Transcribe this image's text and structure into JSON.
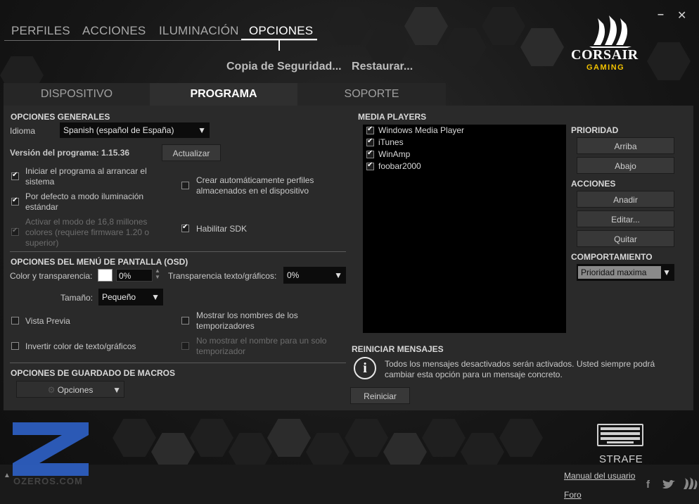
{
  "nav": {
    "tabs": [
      "PERFILES",
      "ACCIONES",
      "ILUMINACIÓN",
      "OPCIONES"
    ],
    "active": "OPCIONES",
    "backup": "Copia de Seguridad...",
    "restore": "Restaurar..."
  },
  "window": {
    "minimize": "–",
    "close": "✕"
  },
  "logo": {
    "brand": "CORSAIR",
    "sub": "GAMING"
  },
  "subtabs": [
    "DISPOSITIVO",
    "PROGRAMA",
    "SOPORTE"
  ],
  "general": {
    "title": "OPCIONES GENERALES",
    "language_label": "Idioma",
    "language_value": "Spanish (español de España)",
    "version": "Versión del programa: 1.15.36",
    "update_button": "Actualizar",
    "start_with_system": "Iniciar el programa al arrancar el sistema",
    "default_lighting": "Por defecto a modo iluminación estándar",
    "sixteen_million": "Activar el modo de 16,8 millones colores (requiere firmware 1.20 o superior)",
    "auto_profiles": "Crear automáticamente perfiles almacenados en el dispositivo",
    "enable_sdk": "Habilitar SDK"
  },
  "osd": {
    "title": "OPCIONES DEL MENÚ DE PANTALLA (OSD)",
    "color_label": "Color y transparencia:",
    "color_value": "0%",
    "text_transparency_label": "Transparencia texto/gráficos:",
    "text_transparency_value": "0%",
    "size_label": "Tamaño:",
    "size_value": "Pequeño",
    "preview": "Vista Previa",
    "show_timers": "Mostrar los nombres de los temporizadores",
    "invert_color": "Invertir color de texto/gráficos",
    "single_timer": "No mostrar el nombre para un solo temporizador"
  },
  "macros": {
    "title": "OPCIONES DE GUARDADO DE MACROS",
    "options": "Opciones"
  },
  "media": {
    "title": "MEDIA PLAYERS",
    "players": [
      "Windows Media Player",
      "iTunes",
      "WinAmp",
      "foobar2000"
    ]
  },
  "priority": {
    "title": "PRIORIDAD",
    "up": "Arriba",
    "down": "Abajo"
  },
  "actions": {
    "title": "ACCIONES",
    "add": "Anadir",
    "edit": "Editar...",
    "remove": "Quitar"
  },
  "behavior": {
    "title": "COMPORTAMIENTO",
    "value": "Prioridad maxima"
  },
  "reset": {
    "title": "REINICIAR MENSAJES",
    "text": "Todos los mensajes desactivados serán activados. Usted siempre podrá cambiar esta opción para un mensaje concreto.",
    "button": "Reiniciar"
  },
  "footer": {
    "device": "STRAFE",
    "manual": "Manual del usuario",
    "forum": "Foro",
    "watermark": "OZEROS.COM"
  }
}
